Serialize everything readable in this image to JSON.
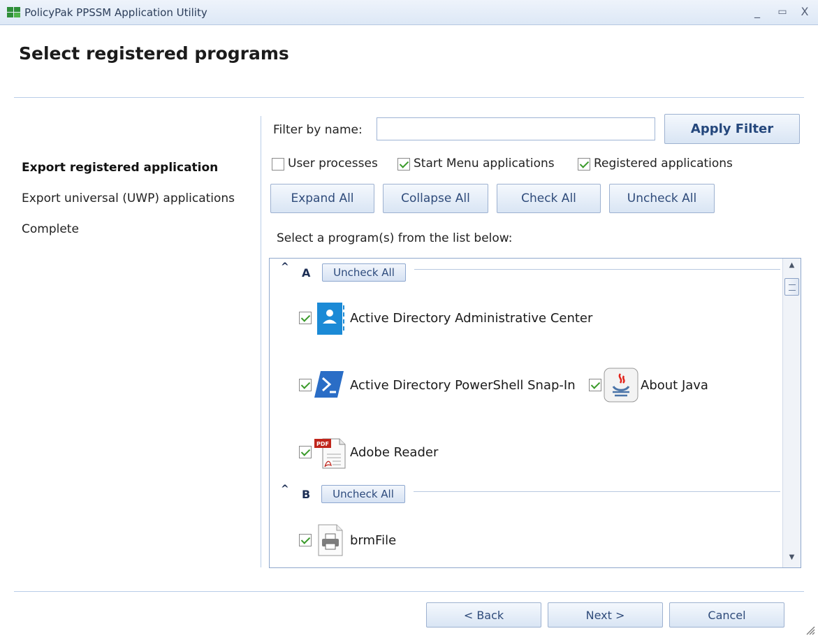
{
  "window": {
    "title": "PolicyPak PPSSM Application Utility",
    "controls": {
      "minimize": "_",
      "maximize": "▭",
      "close": "X"
    }
  },
  "page": {
    "title": "Select registered programs"
  },
  "steps": [
    {
      "label": "Export registered application",
      "active": true
    },
    {
      "label": "Export universal (UWP) applications",
      "active": false
    },
    {
      "label": "Complete",
      "active": false
    }
  ],
  "filter": {
    "label": "Filter by name:",
    "value": "",
    "apply_label": "Apply Filter"
  },
  "options": {
    "user_processes": {
      "label": "User processes",
      "checked": false
    },
    "start_menu": {
      "label": "Start Menu applications",
      "checked": true
    },
    "registered": {
      "label": "Registered applications",
      "checked": true
    }
  },
  "actions": {
    "expand_all": "Expand All",
    "collapse_all": "Collapse All",
    "check_all": "Check All",
    "uncheck_all": "Uncheck All"
  },
  "list": {
    "instruction": "Select a program(s) from the list below:",
    "groups": [
      {
        "letter": "A",
        "toggle_icon": "^",
        "uncheck_label": "Uncheck All",
        "items": [
          {
            "label": "Active Directory Administrative Center",
            "checked": true,
            "icon": "ad-admin-center-icon"
          },
          {
            "label": "Active Directory PowerShell Snap-In",
            "checked": true,
            "icon": "powershell-icon"
          },
          {
            "label": "About Java",
            "checked": true,
            "icon": "java-icon"
          },
          {
            "label": "Adobe Reader",
            "checked": true,
            "icon": "pdf-icon"
          }
        ]
      },
      {
        "letter": "B",
        "toggle_icon": "^",
        "uncheck_label": "Uncheck All",
        "items": [
          {
            "label": "brmFile",
            "checked": true,
            "icon": "printer-file-icon"
          }
        ]
      }
    ]
  },
  "footer": {
    "back": "< Back",
    "next": "Next >",
    "cancel": "Cancel"
  },
  "colors": {
    "accent": "#24477c",
    "separator": "#b9cde8",
    "check": "#3a9a2a"
  }
}
